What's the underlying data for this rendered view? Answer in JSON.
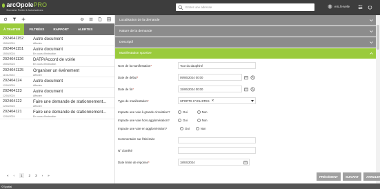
{
  "header": {
    "logo_name_main": "arcOpole",
    "logo_name_accent": "PRO",
    "logo_subtitle": "Domaine Public & Autorisations",
    "search_placeholder": "Entrer une adresse",
    "user_name": "eric.fervelle",
    "icons": [
      "settings-icon",
      "power-icon"
    ]
  },
  "left": {
    "toolbar_icons": [
      "refresh-icon",
      "filter-icon",
      "add-icon",
      "settings-icon",
      "list-icon",
      "document-icon",
      "grid-icon"
    ],
    "tabs": [
      {
        "label": "À TRAITER",
        "active": true
      },
      {
        "label": "FILTRÉES",
        "active": false
      },
      {
        "label": "RAPPORT",
        "active": false
      },
      {
        "label": "ALERTES",
        "active": false
      }
    ],
    "items": [
      {
        "num": "2024041152",
        "date": "15/04/2024",
        "title": "Autre document",
        "status": "Affectée"
      },
      {
        "num": "2024041151",
        "date": "15/04/2024",
        "title": "Autre document",
        "status": "En cours d'instruction"
      },
      {
        "num": "2024041126",
        "date": "15/04/2024",
        "title": "DATP/Accord de voirie",
        "status": "En cours d'instruction"
      },
      {
        "num": "2024041125",
        "date": "11/04/2024",
        "title": "Organiser un événement",
        "status": "Affectée"
      },
      {
        "num": "202404124",
        "date": "12/04/2024",
        "title": "Autre document",
        "status": "Affectée"
      },
      {
        "num": "202404123",
        "date": "12/04/2024",
        "title": "Autre document",
        "status": "Affectée"
      },
      {
        "num": "202404122",
        "date": "12/04/2024",
        "title": "Faire une demande de stationnement...",
        "status": "Affectée"
      },
      {
        "num": "202404121",
        "date": "12/04/2024",
        "title": "Faire une demande de stationnement...",
        "status": "En cours d'instruction"
      }
    ],
    "pager": [
      "«",
      "‹",
      "1",
      "2",
      "3",
      "›",
      "»"
    ]
  },
  "right": {
    "sections": [
      {
        "label": "Localisation de la demande",
        "open": false
      },
      {
        "label": "Nature de la demande",
        "open": false
      },
      {
        "label": "Descriptif",
        "open": false
      },
      {
        "label": "Manifestation sportive",
        "open": true
      }
    ],
    "form": {
      "nom_label": "Nom de la manifestation",
      "nom_value": "Tour du dauphiné",
      "debut_label": "Date de début",
      "debut_value": "09/06/2024 00:00",
      "fin_label": "Date de fin",
      "fin_value": "15/06/2024 00:00",
      "type_label": "Type de manifestation",
      "type_value": "SPORTS CYCLISTES",
      "q1_label": "Impacte une voie à grande circulation?",
      "q2_label": "Impacte une voie hors agglomération?",
      "q3_label": "Impacte une voie en agglomération?",
      "oui": "Oui",
      "non": "Non",
      "commentaire_label": "Commentaire sur l'itinéraire",
      "arrete_label": "N° d'arrêté",
      "limite_label": "Date limite de réponse",
      "limite_value": "18/04/2024"
    }
  },
  "footer": {
    "buttons": [
      "PRÉCÉDENT",
      "SUIVANT",
      "ANNULER"
    ]
  },
  "status": {
    "text": "©Spatial"
  },
  "colors": {
    "accent": "#9acb3c",
    "header": "#3d3d3d",
    "section": "#8c8c8c"
  }
}
